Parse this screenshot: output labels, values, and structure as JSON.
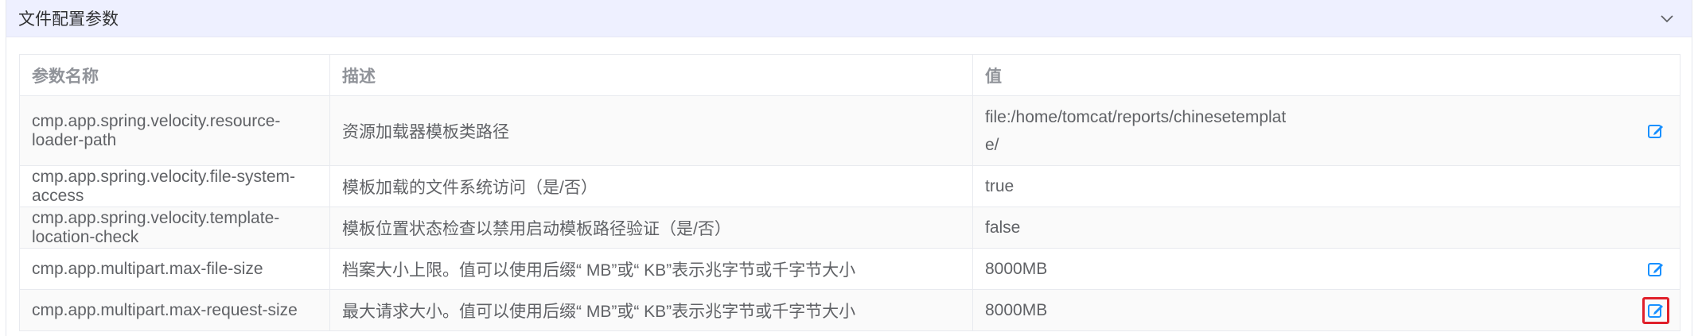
{
  "panel": {
    "title": "文件配置参数",
    "toggle_icon": "chevron-down-icon"
  },
  "table": {
    "headers": [
      "参数名称",
      "描述",
      "值"
    ],
    "rows": [
      {
        "name": "cmp.app.spring.velocity.resource-loader-path",
        "description": "资源加载器模板类路径",
        "value": "file:/home/tomcat/reports/chinesetemplate/",
        "editable": true
      },
      {
        "name": "cmp.app.spring.velocity.file-system-access",
        "description": "模板加载的文件系统访问（是/否）",
        "value": "true",
        "editable": false
      },
      {
        "name": "cmp.app.spring.velocity.template-location-check",
        "description": "模板位置状态检查以禁用启动模板路径验证（是/否）",
        "value": "false",
        "editable": false
      },
      {
        "name": "cmp.app.multipart.max-file-size",
        "description": "档案大小上限。值可以使用后缀“ MB”或“ KB”表示兆字节或千字节大小",
        "value": "8000MB",
        "editable": true
      },
      {
        "name": "cmp.app.multipart.max-request-size",
        "description": "最大请求大小。值可以使用后缀“ MB”或“ KB”表示兆字节或千字节大小",
        "value": "8000MB",
        "editable": true,
        "highlighted": true
      }
    ]
  },
  "colors": {
    "header_bg": "#eef0ff",
    "edit_icon": "#1890ff",
    "highlight_border": "#e0202a"
  }
}
